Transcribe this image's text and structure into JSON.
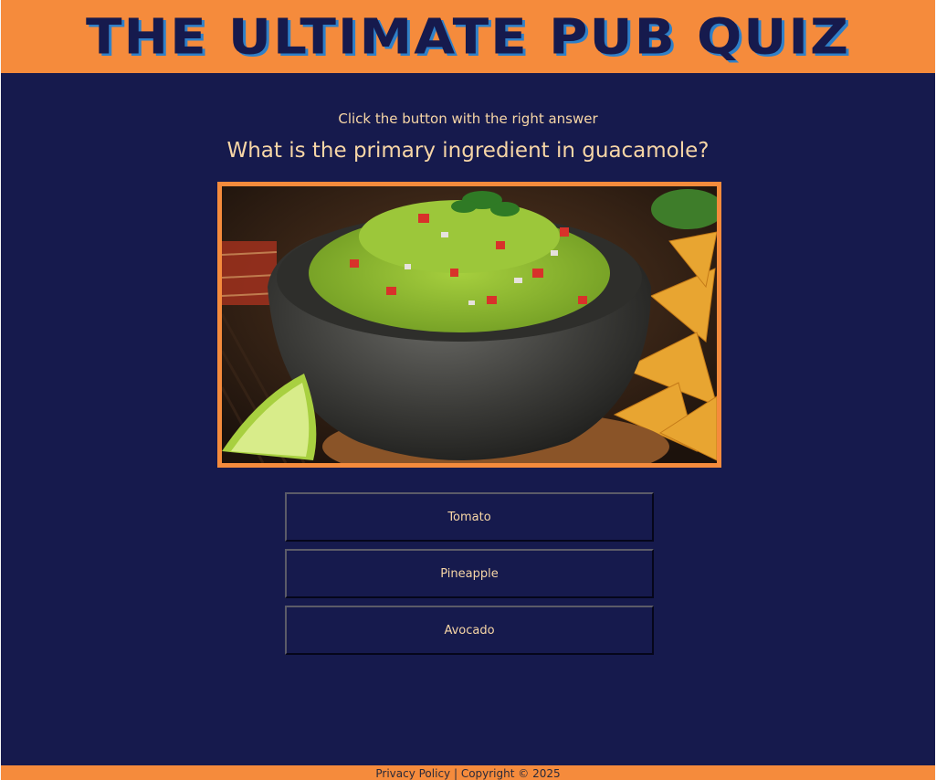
{
  "header": {
    "title": "THE ULTIMATE PUB QUIZ"
  },
  "quiz": {
    "instruction": "Click the button with the right answer",
    "question": "What is the primary ingredient in guacamole?",
    "image_subject": "guacamole-in-molcajete",
    "answers": [
      {
        "label": "Tomato"
      },
      {
        "label": "Pineapple"
      },
      {
        "label": "Avocado"
      }
    ]
  },
  "footer": {
    "privacy_link": "Privacy Policy",
    "separator": " | ",
    "copyright": "Copyright © 2025"
  },
  "colors": {
    "background": "#161a4d",
    "accent": "#f58b3c",
    "text": "#f7d6a6"
  }
}
